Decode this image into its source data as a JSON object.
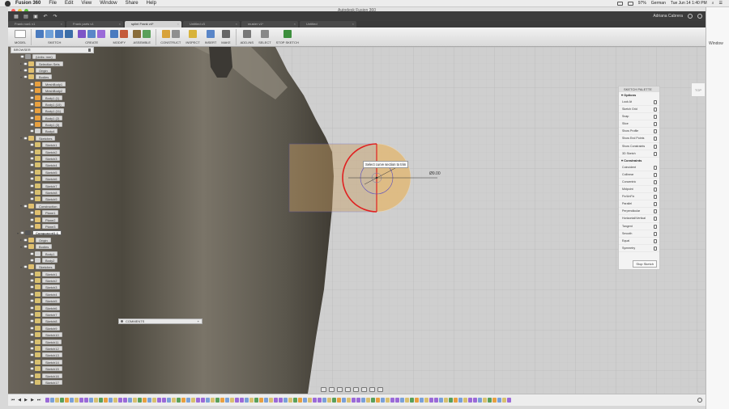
{
  "menubar": {
    "app_name": "Fusion 360",
    "items": [
      "File",
      "Edit",
      "View",
      "Window",
      "Share",
      "Help"
    ],
    "status": {
      "battery": "97%",
      "language": "German",
      "clock": "Tue Jun 14  1:40 PM"
    }
  },
  "window": {
    "title": "Autodesk Fusion 360"
  },
  "qat": {
    "user_name": "Adriana Cabrera"
  },
  "tabs": [
    {
      "label": "Frank row1 v1",
      "active": false
    },
    {
      "label": "Frank parts v1",
      "active": false
    },
    {
      "label": "splint Frank v4*",
      "active": true
    },
    {
      "label": "Untitled v3",
      "active": false
    },
    {
      "label": "muster v1*",
      "active": false
    },
    {
      "label": "Untitled",
      "active": false
    }
  ],
  "ribbon": {
    "workspace": "MODEL",
    "groups": [
      {
        "label": "SKETCH",
        "colors": [
          "#4a7bbf",
          "#6fa0d8",
          "#4a7bbf",
          "#3b6ea8"
        ]
      },
      {
        "label": "CREATE",
        "colors": [
          "#7d55c7",
          "#5a86c8",
          "#9b6ad8"
        ]
      },
      {
        "label": "MODIFY",
        "colors": [
          "#4a7bbf",
          "#c45a3a"
        ]
      },
      {
        "label": "ASSEMBLE",
        "colors": [
          "#8a6d3b",
          "#5aa05a"
        ]
      },
      {
        "label": "CONSTRUCT",
        "colors": [
          "#d8a23a",
          "#8f8f8f"
        ]
      },
      {
        "label": "INSPECT",
        "colors": [
          "#d8b33a"
        ]
      },
      {
        "label": "INSERT",
        "colors": [
          "#5a86c8"
        ]
      },
      {
        "label": "MAKE",
        "colors": [
          "#666666"
        ]
      },
      {
        "label": "ADD-INS",
        "colors": [
          "#777777"
        ]
      },
      {
        "label": "SELECT",
        "colors": [
          "#888888"
        ]
      },
      {
        "label": "STOP SKETCH",
        "colors": [
          "#3d8f3d"
        ]
      }
    ]
  },
  "browser": {
    "title": "BROWSER",
    "nodes": [
      {
        "label": "(Units: mm)",
        "indent": 1,
        "icon": "#999999",
        "tri": ""
      },
      {
        "label": "Selection Sets",
        "indent": 2,
        "icon": "#e0c070",
        "tri": "▸"
      },
      {
        "label": "Origin",
        "indent": 2,
        "icon": "#e0c070",
        "tri": "▸"
      },
      {
        "label": "Bodies",
        "indent": 2,
        "icon": "#e0c070",
        "tri": "▾"
      },
      {
        "label": "MeshBody1",
        "indent": 4,
        "icon": "#e8a040",
        "tri": ""
      },
      {
        "label": "MeshBody2",
        "indent": 4,
        "icon": "#e8a040",
        "tri": ""
      },
      {
        "label": "Body1 (1)",
        "indent": 4,
        "icon": "#e8a040",
        "tri": ""
      },
      {
        "label": "Body1 (10)",
        "indent": 4,
        "icon": "#e8a040",
        "tri": ""
      },
      {
        "label": "Body1 (11)",
        "indent": 4,
        "icon": "#e8a040",
        "tri": ""
      },
      {
        "label": "Body1 (2)",
        "indent": 4,
        "icon": "#e8a040",
        "tri": ""
      },
      {
        "label": "Body1 (3)",
        "indent": 4,
        "icon": "#e8a040",
        "tri": ""
      },
      {
        "label": "Body4",
        "indent": 4,
        "icon": "#cfcfcf",
        "tri": ""
      },
      {
        "label": "Sketches",
        "indent": 2,
        "icon": "#e0c070",
        "tri": "▾"
      },
      {
        "label": "Sketch1",
        "indent": 4,
        "icon": "#d8c070",
        "tri": ""
      },
      {
        "label": "Sketch2",
        "indent": 4,
        "icon": "#d8c070",
        "tri": ""
      },
      {
        "label": "Sketch3",
        "indent": 4,
        "icon": "#d8c070",
        "tri": ""
      },
      {
        "label": "Sketch4",
        "indent": 4,
        "icon": "#d8c070",
        "tri": ""
      },
      {
        "label": "Sketch5",
        "indent": 4,
        "icon": "#d8c070",
        "tri": ""
      },
      {
        "label": "Sketch6",
        "indent": 4,
        "icon": "#d8c070",
        "tri": ""
      },
      {
        "label": "Sketch7",
        "indent": 4,
        "icon": "#d8c070",
        "tri": ""
      },
      {
        "label": "Sketch8",
        "indent": 4,
        "icon": "#d8c070",
        "tri": ""
      },
      {
        "label": "Sketch9",
        "indent": 4,
        "icon": "#d8c070",
        "tri": ""
      },
      {
        "label": "Construction",
        "indent": 2,
        "icon": "#e0c070",
        "tri": "▾"
      },
      {
        "label": "Plane1",
        "indent": 4,
        "icon": "#e0c070",
        "tri": ""
      },
      {
        "label": "Plane2",
        "indent": 4,
        "icon": "#e0c070",
        "tri": ""
      },
      {
        "label": "Plane3",
        "indent": 4,
        "icon": "#e0c070",
        "tri": ""
      },
      {
        "label": "Component1:1",
        "indent": 1,
        "icon": "#555555",
        "tri": "▾",
        "comp": true
      },
      {
        "label": "Origin",
        "indent": 2,
        "icon": "#e0c070",
        "tri": "▸"
      },
      {
        "label": "Bodies",
        "indent": 2,
        "icon": "#e0c070",
        "tri": "▾"
      },
      {
        "label": "Body1",
        "indent": 4,
        "icon": "#cfcfcf",
        "tri": ""
      },
      {
        "label": "Body2",
        "indent": 4,
        "icon": "#cfcfcf",
        "tri": ""
      },
      {
        "label": "Sketches",
        "indent": 2,
        "icon": "#e0c070",
        "tri": "▾"
      },
      {
        "label": "Sketch1",
        "indent": 4,
        "icon": "#d8c070",
        "tri": ""
      },
      {
        "label": "Sketch2",
        "indent": 4,
        "icon": "#d8c070",
        "tri": ""
      },
      {
        "label": "Sketch3",
        "indent": 4,
        "icon": "#d8c070",
        "tri": ""
      },
      {
        "label": "Sketch4",
        "indent": 4,
        "icon": "#d8c070",
        "tri": ""
      },
      {
        "label": "Sketch5",
        "indent": 4,
        "icon": "#d8c070",
        "tri": ""
      },
      {
        "label": "Sketch6",
        "indent": 4,
        "icon": "#d8c070",
        "tri": ""
      },
      {
        "label": "Sketch7",
        "indent": 4,
        "icon": "#d8c070",
        "tri": ""
      },
      {
        "label": "Sketch8",
        "indent": 4,
        "icon": "#d8c070",
        "tri": ""
      },
      {
        "label": "Sketch9",
        "indent": 4,
        "icon": "#d8c070",
        "tri": ""
      },
      {
        "label": "Sketch10",
        "indent": 4,
        "icon": "#d8c070",
        "tri": ""
      },
      {
        "label": "Sketch11",
        "indent": 4,
        "icon": "#d8c070",
        "tri": ""
      },
      {
        "label": "Sketch12",
        "indent": 4,
        "icon": "#d8c070",
        "tri": ""
      },
      {
        "label": "Sketch13",
        "indent": 4,
        "icon": "#d8c070",
        "tri": ""
      },
      {
        "label": "Sketch14",
        "indent": 4,
        "icon": "#d8c070",
        "tri": ""
      },
      {
        "label": "Sketch15",
        "indent": 4,
        "icon": "#d8c070",
        "tri": ""
      },
      {
        "label": "Sketch16",
        "indent": 4,
        "icon": "#d8c070",
        "tri": ""
      },
      {
        "label": "Sketch17",
        "indent": 4,
        "icon": "#d8c070",
        "tri": ""
      }
    ]
  },
  "palette": {
    "title": "SKETCH PALETTE",
    "options_title": "Options",
    "options": [
      "Look At",
      "Sketch Grid",
      "Snap",
      "Slice",
      "Show Profile",
      "Show End Points",
      "Show Constraints",
      "3D Sketch"
    ],
    "constraints_title": "Constraints",
    "constraints": [
      "Coincident",
      "Collinear",
      "Concentric",
      "Midpoint",
      "Fix/UnFix",
      "Parallel",
      "Perpendicular",
      "Horizontal/Vertical",
      "Tangent",
      "Smooth",
      "Equal",
      "Symmetry"
    ],
    "stop_label": "Stop Sketch"
  },
  "viewport": {
    "tooltip": "Select curve section to trim",
    "dimension": "Ø9.00",
    "viewcube_label": "TOP",
    "colors": {
      "profile": "#e0b878",
      "trim_arc": "#e02020",
      "sketch_line": "#5a4fc0",
      "grid": "#c2c2c2"
    }
  },
  "comments": {
    "title": "COMMENTS"
  },
  "dock": {
    "side_label": "Window"
  }
}
